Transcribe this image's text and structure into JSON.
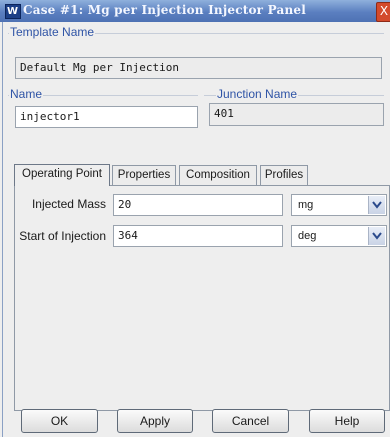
{
  "window": {
    "title": "Case #1: Mg per Injection Injector Panel",
    "icon_glyph": "W",
    "close_glyph": "X"
  },
  "template": {
    "label": "Template Name",
    "value": "Default Mg per Injection"
  },
  "name": {
    "label": "Name",
    "value": "injector1"
  },
  "junction": {
    "label": "Junction Name",
    "value": "401"
  },
  "tabs": [
    {
      "label": "Operating Point",
      "active": true
    },
    {
      "label": "Properties",
      "active": false
    },
    {
      "label": "Composition",
      "active": false
    },
    {
      "label": "Profiles",
      "active": false
    }
  ],
  "operating_point": {
    "rows": [
      {
        "label": "Injected Mass",
        "value": "20",
        "unit": "mg"
      },
      {
        "label": "Start of Injection",
        "value": "364",
        "unit": "deg"
      }
    ]
  },
  "buttons": {
    "ok": "OK",
    "apply": "Apply",
    "cancel": "Cancel",
    "help": "Help"
  },
  "colors": {
    "title_bar": "#5b7fc0",
    "group_label": "#2f54a6",
    "panel_bg": "#eeeeee"
  }
}
